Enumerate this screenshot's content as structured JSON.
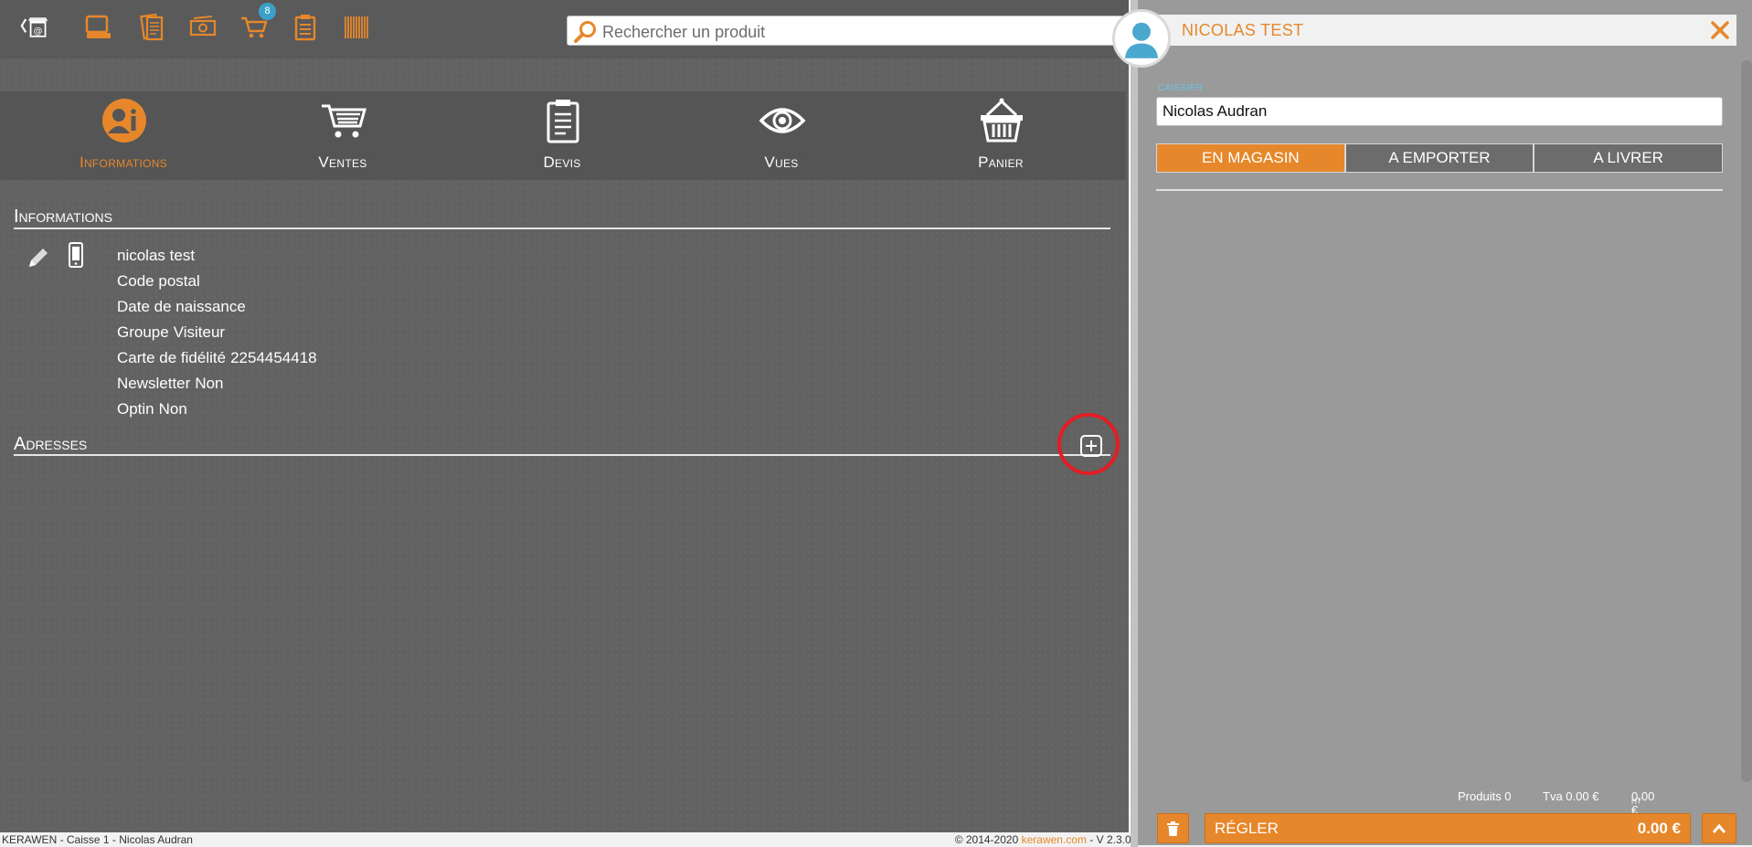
{
  "toolbar": {
    "cart_badge": "8",
    "search_placeholder": "Rechercher un produit"
  },
  "tabs": [
    {
      "label": "Informations",
      "active": true
    },
    {
      "label": "Ventes",
      "active": false
    },
    {
      "label": "Devis",
      "active": false
    },
    {
      "label": "Vues",
      "active": false
    },
    {
      "label": "Panier",
      "active": false
    }
  ],
  "informations": {
    "title": "Informations",
    "name": "nicolas test",
    "postal_code_label": "Code postal",
    "birthdate_label": "Date de naissance",
    "group_label": "Groupe",
    "group_value": "Visiteur",
    "loyalty_label": "Carte de fidélité",
    "loyalty_value": "2254454418",
    "newsletter_label": "Newsletter",
    "newsletter_value": "Non",
    "optin_label": "Optin",
    "optin_value": "Non"
  },
  "addresses": {
    "title": "Adresses"
  },
  "footer": {
    "left": "KERAWEN - Caisse 1 - Nicolas Audran",
    "copyright": "© 2014-2020 ",
    "link": "kerawen.com",
    "version": " - V 2.3.0 -"
  },
  "customer": {
    "name": "NICOLAS TEST"
  },
  "cashier": {
    "label": "CAISSIER",
    "value": "Nicolas Audran"
  },
  "modes": [
    {
      "label": "EN MAGASIN",
      "active": true
    },
    {
      "label": "A EMPORTER",
      "active": false
    },
    {
      "label": "A LIVRER",
      "active": false
    }
  ],
  "totals": {
    "products": "Produits 0",
    "vat": "Tva 0.00 €",
    "ht": "0.00 €",
    "ht_suffix": "HT"
  },
  "pay": {
    "label": "RÉGLER",
    "amount": "0.00 €"
  },
  "colors": {
    "accent": "#e5872a",
    "panel": "#626263",
    "right_panel": "#9a9a9a",
    "info": "#6cc4e8",
    "highlight_ring": "#e31d23"
  },
  "icons": [
    "back-shop-icon",
    "terminal-icon",
    "receipts-icon",
    "cash-icon",
    "cart-icon",
    "clipboard-icon",
    "barcode-icon",
    "search-icon",
    "info-person-icon",
    "sales-cart-icon",
    "quote-clipboard-icon",
    "eye-icon",
    "basket-icon",
    "pencil-icon",
    "phone-icon",
    "add-square-icon",
    "user-avatar-icon",
    "close-icon",
    "trash-icon",
    "chevron-up-icon"
  ]
}
